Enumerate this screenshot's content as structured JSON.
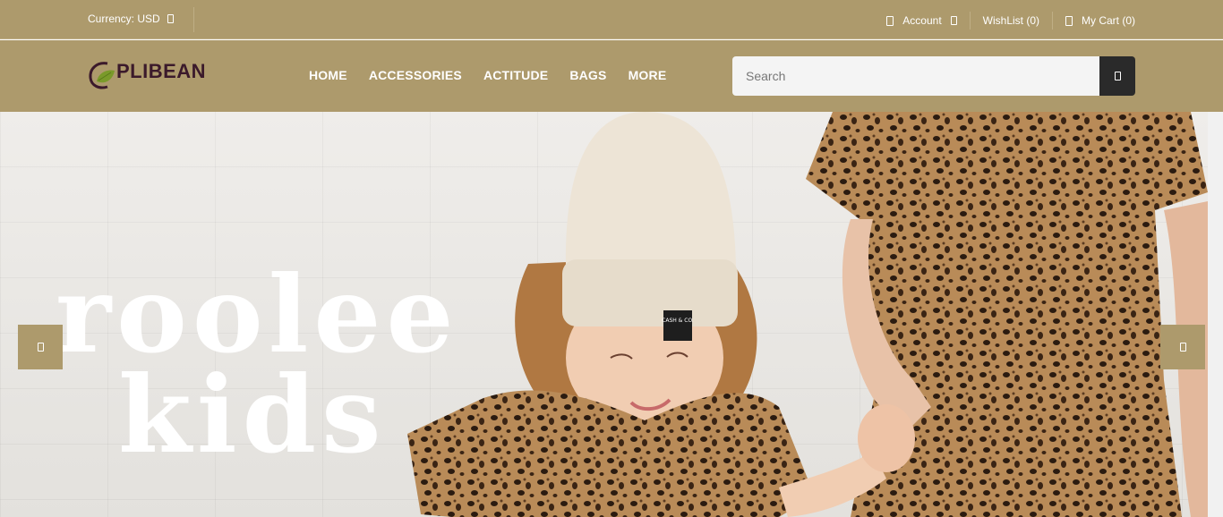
{
  "topbar": {
    "currency_label": "Currency: USD",
    "account_label": "Account",
    "wishlist_label": "WishList (0)",
    "cart_label": "My Cart (0)"
  },
  "header": {
    "logo_text": "PLIBEAN",
    "nav": [
      {
        "label": "HOME"
      },
      {
        "label": "ACCESSORIES"
      },
      {
        "label": "ACTITUDE"
      },
      {
        "label": "BAGS"
      },
      {
        "label": "MORE"
      }
    ],
    "search": {
      "placeholder": "Search",
      "value": ""
    }
  },
  "hero": {
    "line1": "roolee",
    "line2": "kids",
    "hat_tag": "CASH & CO."
  },
  "colors": {
    "header_bg": "#ad9a6c",
    "logo_text": "#3b1a2b",
    "search_button": "#2a2a2a"
  },
  "icons": {
    "currency": "chevron-down-icon",
    "account": "user-icon",
    "account_caret": "chevron-down-icon",
    "cart": "cart-icon",
    "search": "search-icon",
    "slider_prev": "arrow-left-icon",
    "slider_next": "arrow-right-icon"
  }
}
